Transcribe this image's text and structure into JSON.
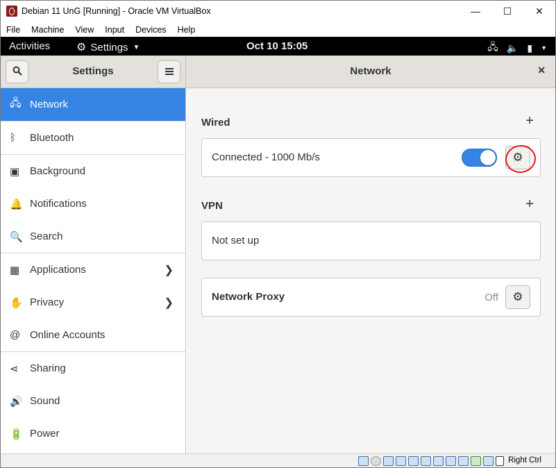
{
  "window": {
    "title": "Debian 11 UnG [Running] - Oracle VM VirtualBox",
    "controls": {
      "minimize": "—",
      "maximize": "☐",
      "close": "✕"
    }
  },
  "menubar": [
    "File",
    "Machine",
    "View",
    "Input",
    "Devices",
    "Help"
  ],
  "topbar": {
    "activities": "Activities",
    "app_name": "Settings",
    "clock": "Oct 10  15:05"
  },
  "headerbar": {
    "left_title": "Settings",
    "right_title": "Network"
  },
  "sidebar": {
    "items": [
      {
        "label": "Network",
        "icon": "network-wired-icon",
        "glyph": "🖧",
        "active": true,
        "chevron": false
      },
      {
        "label": "Bluetooth",
        "icon": "bluetooth-icon",
        "glyph": "ᛒ",
        "active": false,
        "chevron": false
      },
      {
        "label": "Background",
        "icon": "background-icon",
        "glyph": "▣",
        "active": false,
        "chevron": false
      },
      {
        "label": "Notifications",
        "icon": "bell-icon",
        "glyph": "🔔",
        "active": false,
        "chevron": false
      },
      {
        "label": "Search",
        "icon": "search-icon",
        "glyph": "🔍",
        "active": false,
        "chevron": false
      },
      {
        "label": "Applications",
        "icon": "applications-grid-icon",
        "glyph": "▦",
        "active": false,
        "chevron": true
      },
      {
        "label": "Privacy",
        "icon": "hand-icon",
        "glyph": "✋",
        "active": false,
        "chevron": true
      },
      {
        "label": "Online Accounts",
        "icon": "at-sign-icon",
        "glyph": "@",
        "active": false,
        "chevron": false
      },
      {
        "label": "Sharing",
        "icon": "share-icon",
        "glyph": "⋖",
        "active": false,
        "chevron": false
      },
      {
        "label": "Sound",
        "icon": "speaker-icon",
        "glyph": "🔊",
        "active": false,
        "chevron": false
      },
      {
        "label": "Power",
        "icon": "power-icon",
        "glyph": "🔋",
        "active": false,
        "chevron": false
      }
    ]
  },
  "main": {
    "wired": {
      "title": "Wired",
      "connection_label": "Connected - 1000 Mb/s",
      "toggle_on": true
    },
    "vpn": {
      "title": "VPN",
      "empty_label": "Not set up"
    },
    "proxy": {
      "label": "Network Proxy",
      "status": "Off"
    }
  },
  "statusbar": {
    "host_key": "Right Ctrl"
  },
  "colors": {
    "accent": "#3584e4",
    "annotation": "#e31818"
  }
}
